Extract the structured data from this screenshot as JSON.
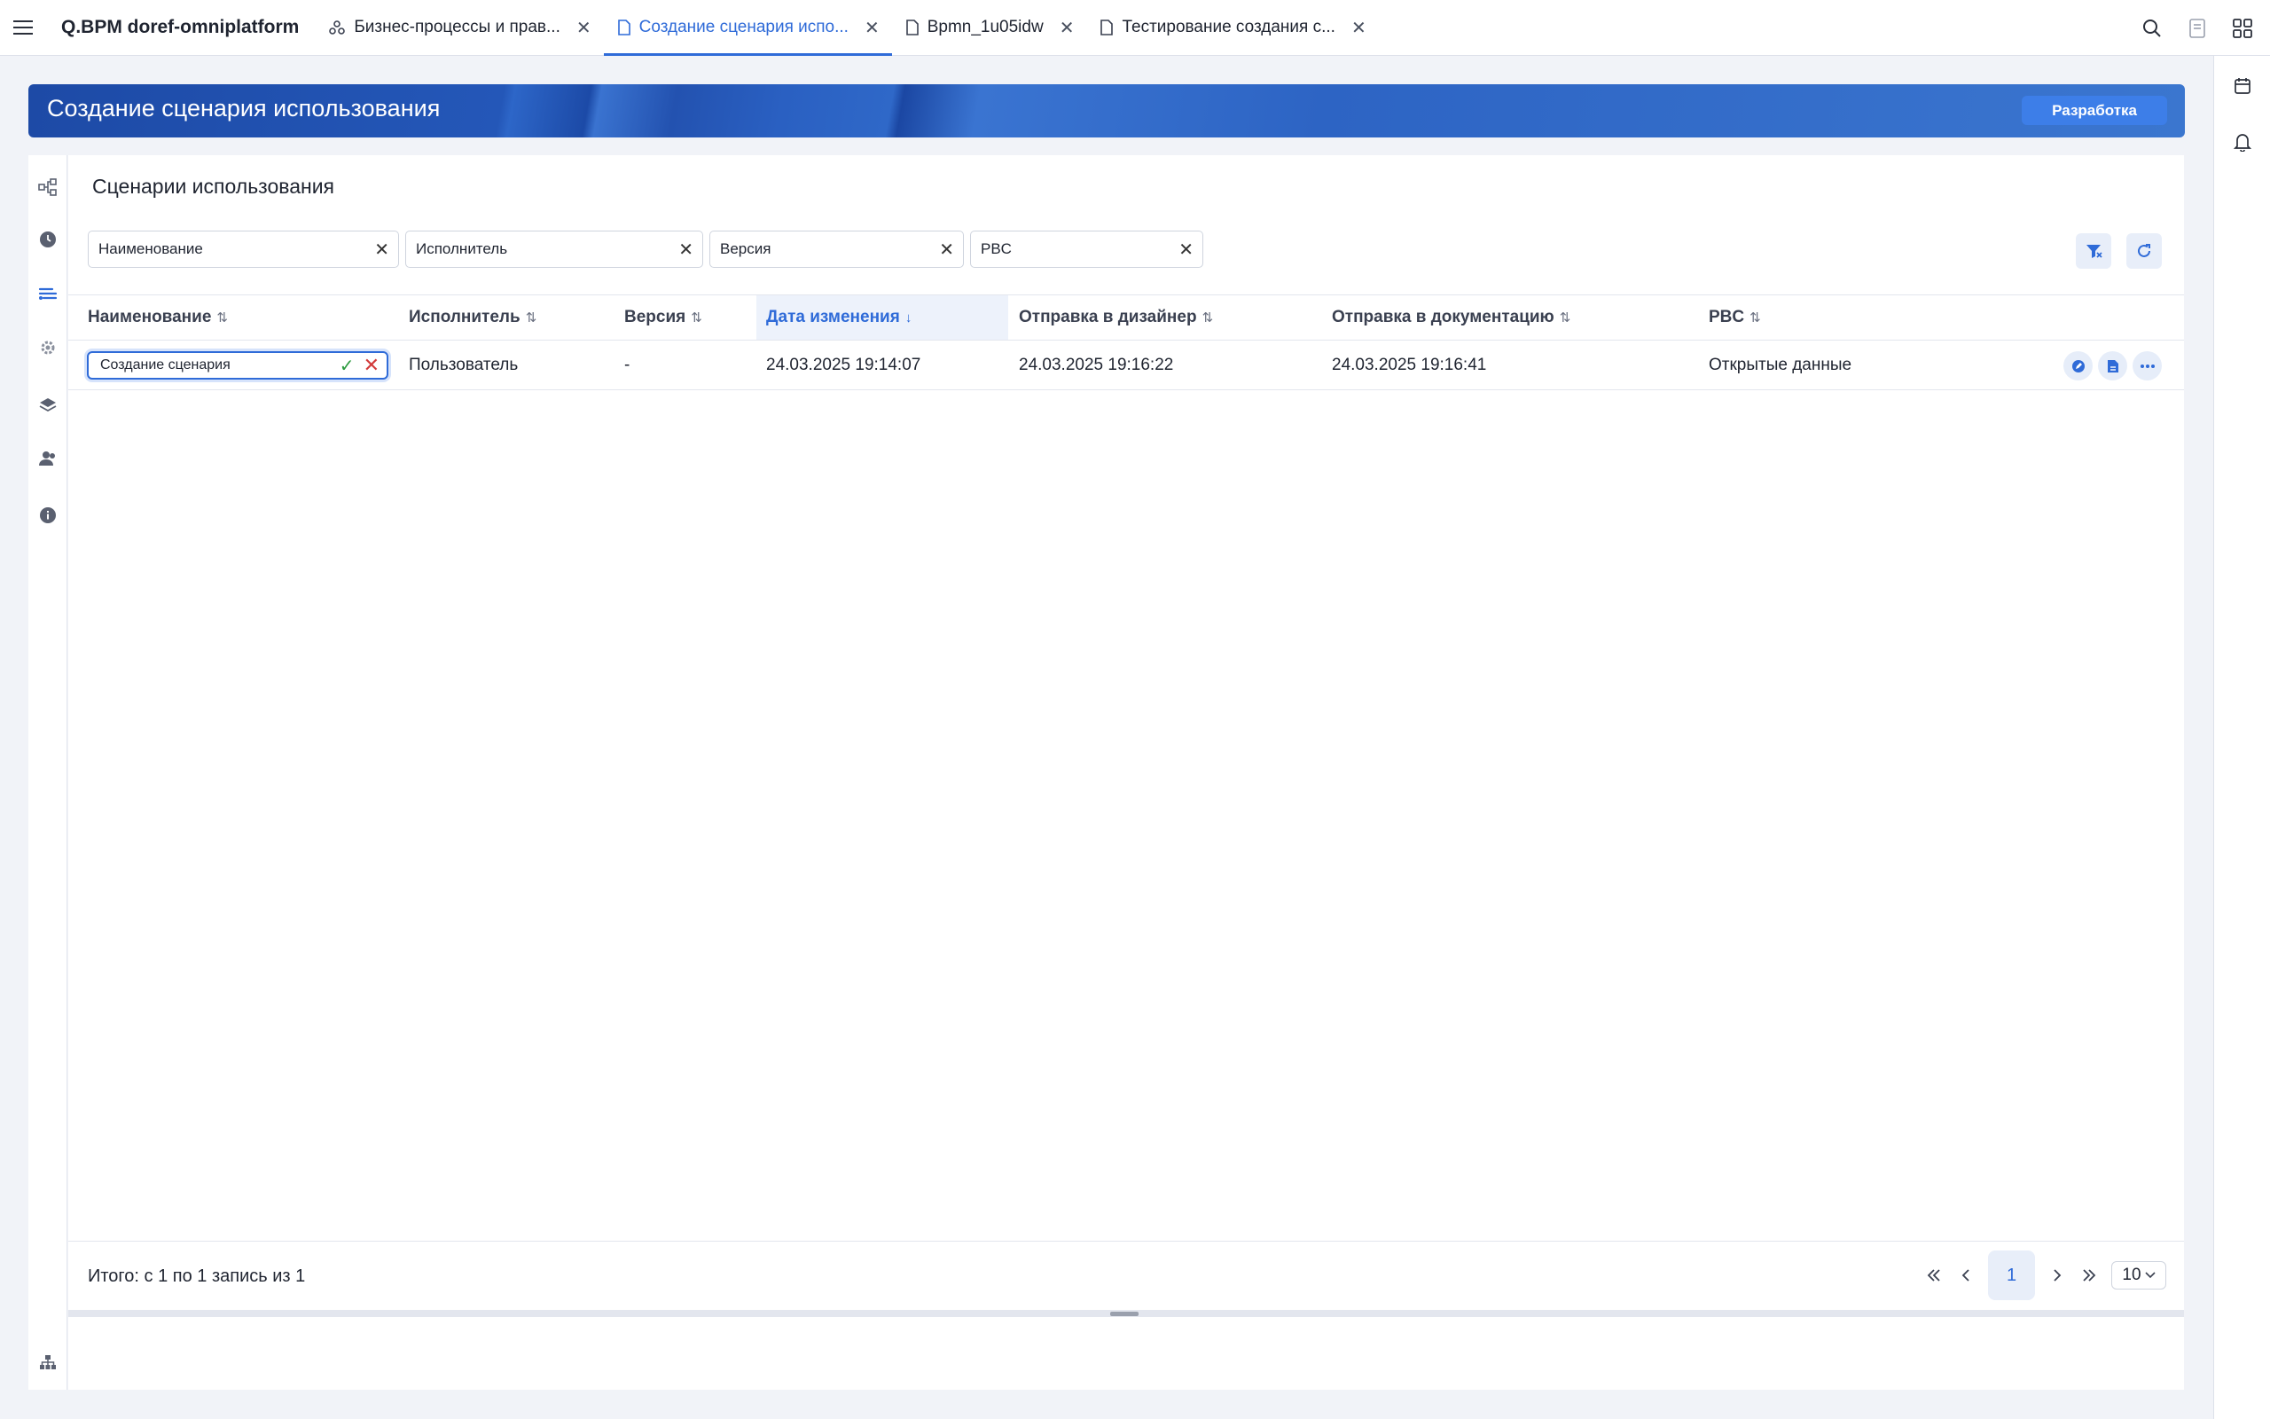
{
  "app": {
    "title": "Q.BPM doref-omniplatform"
  },
  "tabs": [
    {
      "label": "Бизнес-процессы и прав...",
      "icon": "process-icon",
      "active": false
    },
    {
      "label": "Создание сценария испо...",
      "icon": "document-icon",
      "active": true
    },
    {
      "label": "Bpmn_1u05idw",
      "icon": "document-icon",
      "active": false
    },
    {
      "label": "Тестирование создания с...",
      "icon": "document-icon",
      "active": false
    }
  ],
  "banner": {
    "title": "Создание сценария использования",
    "env_badge": "Разработка"
  },
  "panel": {
    "title": "Сценарии использования"
  },
  "filters": [
    {
      "placeholder": "Наименование"
    },
    {
      "placeholder": "Исполнитель"
    },
    {
      "placeholder": "Версия"
    },
    {
      "placeholder": "PBC"
    }
  ],
  "table": {
    "columns": [
      {
        "label": "Наименование",
        "sort": "⇅"
      },
      {
        "label": "Исполнитель",
        "sort": "⇅"
      },
      {
        "label": "Версия",
        "sort": "⇅"
      },
      {
        "label": "Дата изменения",
        "sort": "↓"
      },
      {
        "label": "Отправка в дизайнер",
        "sort": "⇅"
      },
      {
        "label": "Отправка в документацию",
        "sort": "⇅"
      },
      {
        "label": "PBC",
        "sort": "⇅"
      }
    ],
    "rows": [
      {
        "name_editing": "Создание сценария",
        "performer": "Пользователь",
        "version": "-",
        "modified": "24.03.2025 19:14:07",
        "sent_designer": "24.03.2025 19:16:22",
        "sent_docs": "24.03.2025 19:16:41",
        "pbc": "Открытые данные"
      }
    ]
  },
  "footer": {
    "total": "Итого: с 1 по 1 запись из 1",
    "current_page": "1",
    "page_size": "10"
  },
  "colors": {
    "accent": "#2f6bd8",
    "banner": "#2457b8",
    "ok": "#2b9a3e",
    "cancel": "#d23a3a"
  }
}
